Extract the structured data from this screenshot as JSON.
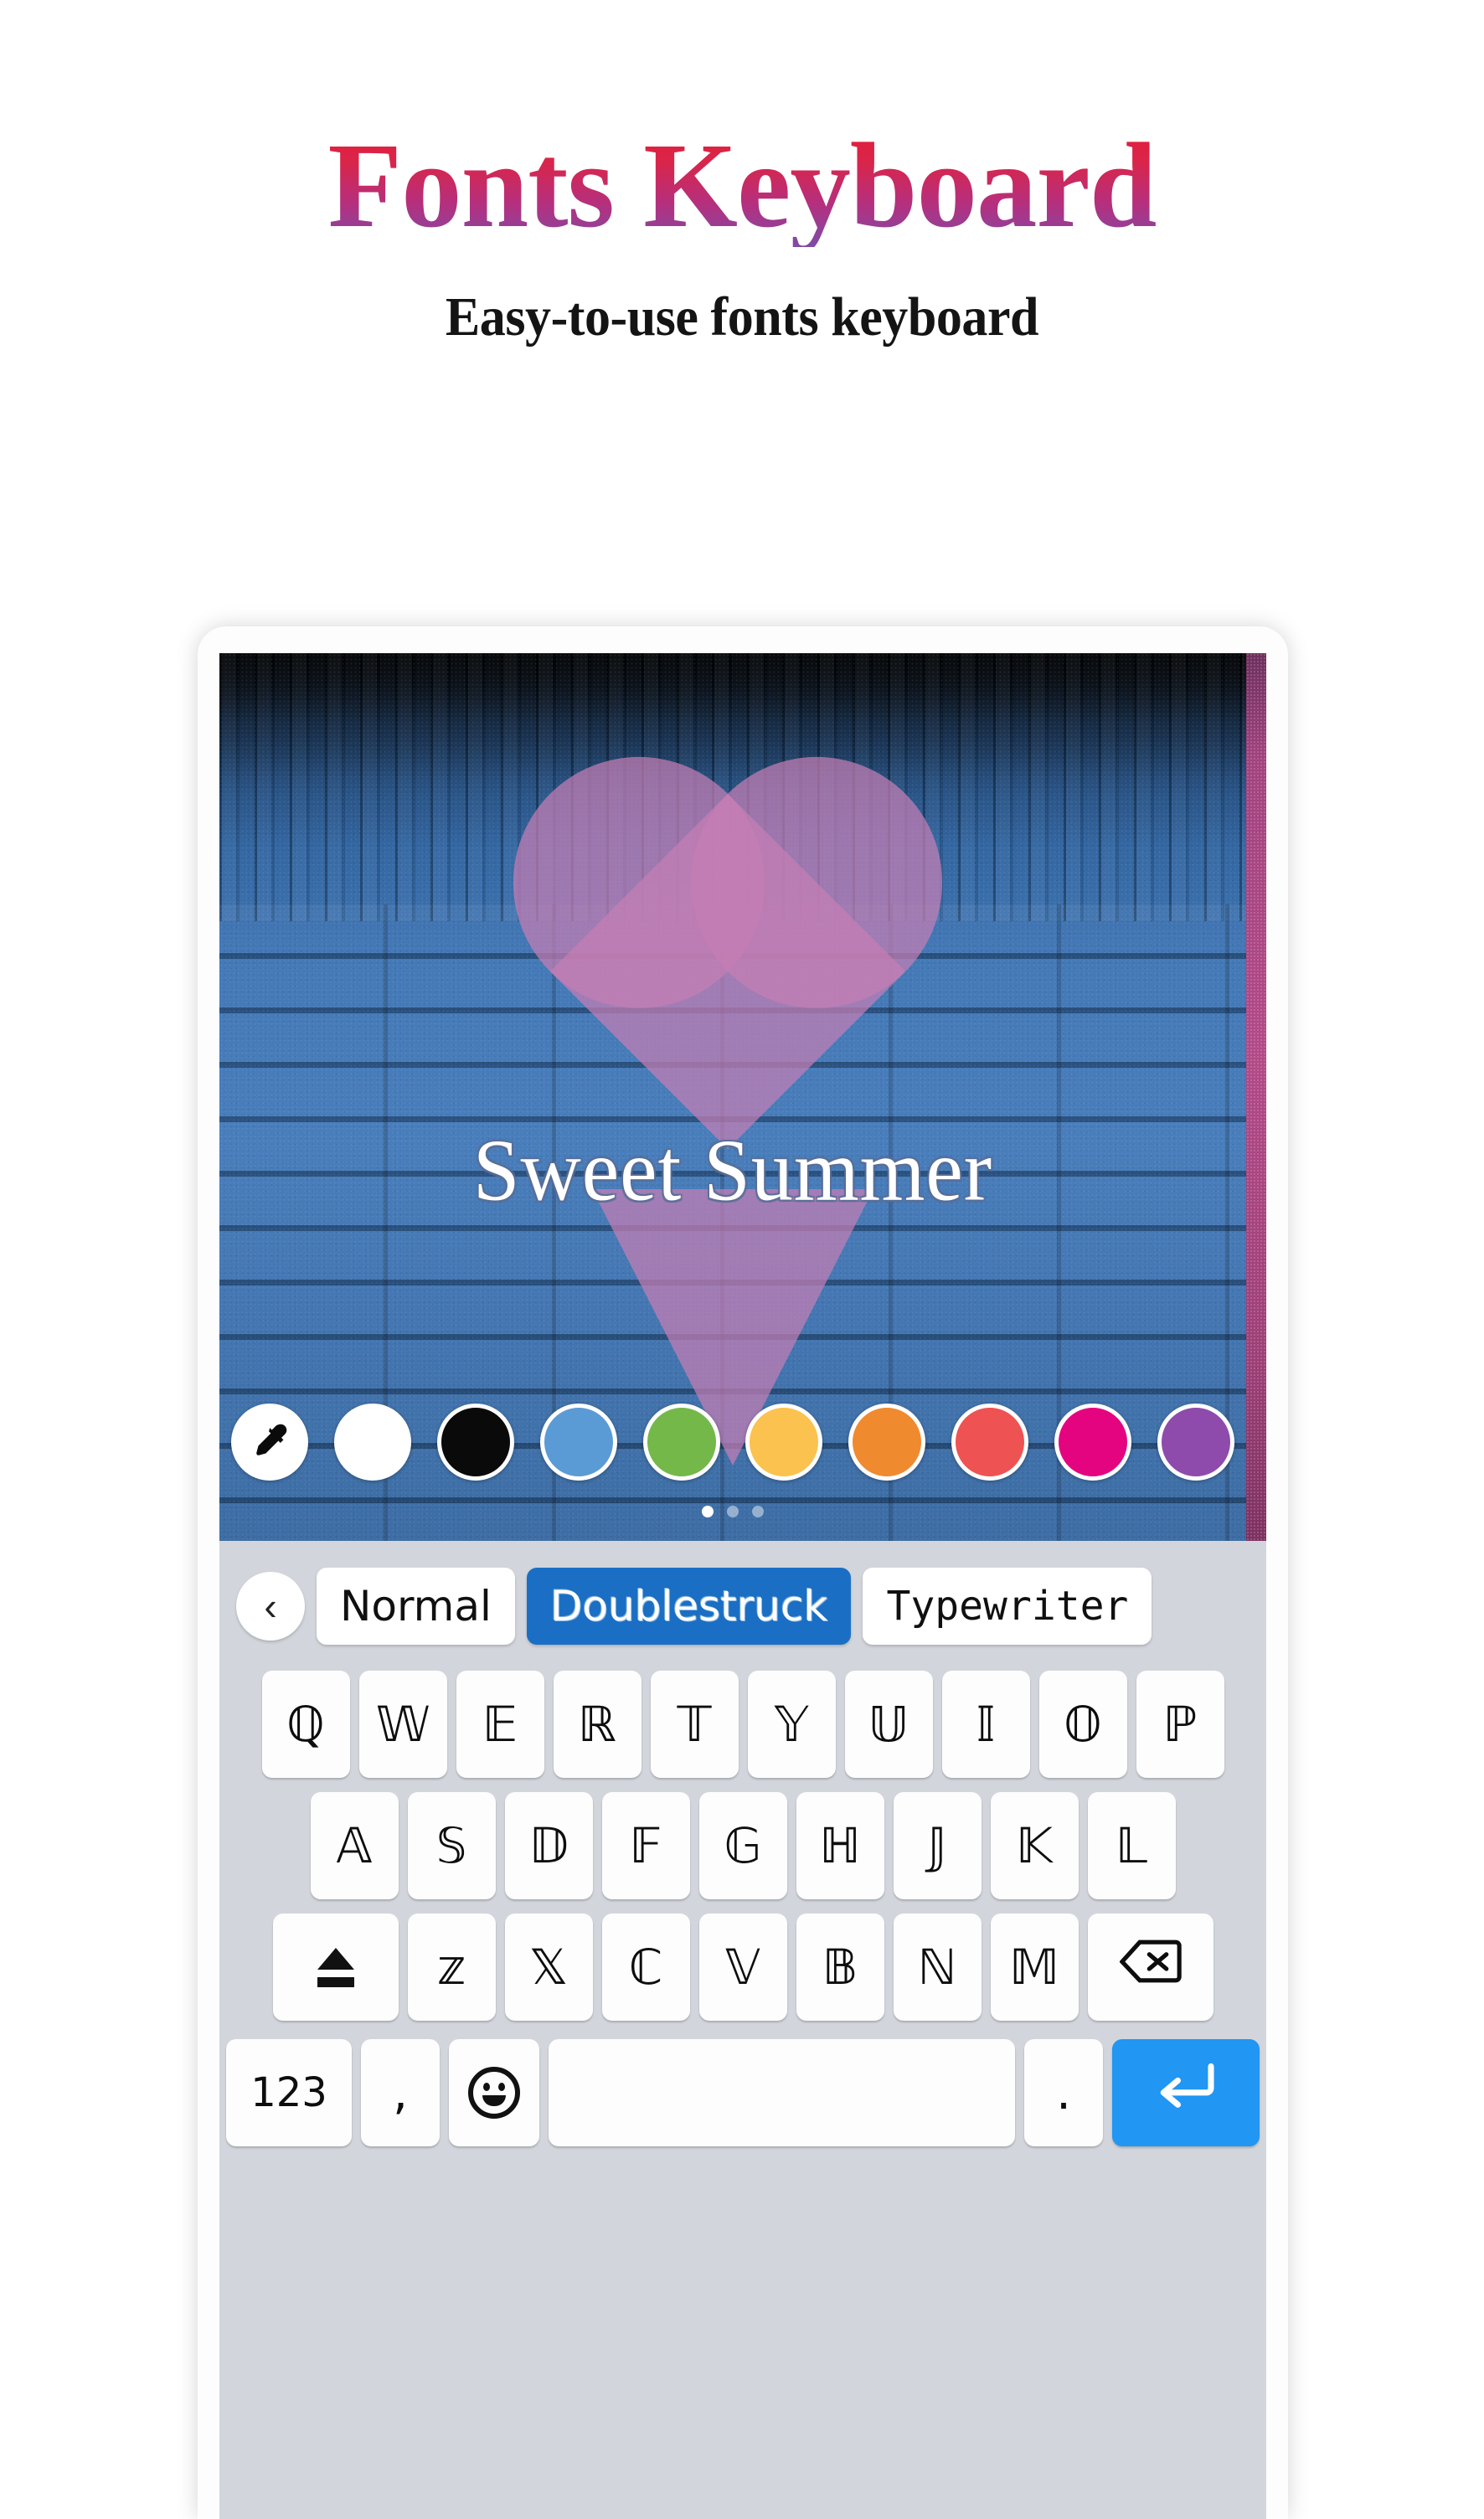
{
  "header": {
    "title": "Fonts Keyboard",
    "subtitle": "Easy-to-use fonts keyboard",
    "title_gradient_from": "#e51d38",
    "title_gradient_to": "#7e4ba6",
    "subtitle_color": "#141414"
  },
  "phone": {
    "canvas": {
      "text": "Sweet Summer",
      "text_color": "#ffffff",
      "wallpaper": "blue-brick-wall-with-pink-heart",
      "heart_color": "#c57eb4",
      "wall_color": "#3f77b8",
      "right_edge_color": "#b24a87"
    },
    "colors": {
      "picker_label": "eyedropper",
      "swatches": [
        {
          "name": "color-picker",
          "hex": "#ffffff",
          "icon": "eyedropper-icon"
        },
        {
          "name": "white",
          "hex": "#ffffff"
        },
        {
          "name": "black",
          "hex": "#0a0a0a"
        },
        {
          "name": "blue",
          "hex": "#5b9bd5"
        },
        {
          "name": "green",
          "hex": "#74b84a"
        },
        {
          "name": "yellow",
          "hex": "#fbc24f"
        },
        {
          "name": "orange",
          "hex": "#f08a2e"
        },
        {
          "name": "coral-red",
          "hex": "#ef5252"
        },
        {
          "name": "magenta",
          "hex": "#e5047f"
        },
        {
          "name": "purple",
          "hex": "#8e4bab"
        }
      ],
      "page_dots": {
        "count": 3,
        "active_index": 0
      }
    },
    "font_bar": {
      "back_icon": "‹",
      "items": [
        {
          "label": "Normal",
          "selected": false
        },
        {
          "label": "Doublestruck",
          "selected": true
        },
        {
          "label": "Typewriter",
          "selected": false
        }
      ],
      "selected_bg": "#1a6fc4"
    },
    "keyboard": {
      "background": "#d2d6dc",
      "key_background": "#fdfdfd",
      "enter_background": "#2196f3",
      "row1": [
        "ℚ",
        "𝕎",
        "𝔼",
        "ℝ",
        "𝕋",
        "𝕐",
        "𝕌",
        "𝕀",
        "𝕆",
        "ℙ"
      ],
      "row2": [
        "𝔸",
        "𝕊",
        "𝔻",
        "𝔽",
        "𝔾",
        "ℍ",
        "𝕁",
        "𝕂",
        "𝕃"
      ],
      "row3": [
        "𝕫",
        "𝕏",
        "ℂ",
        "𝕍",
        "𝔹",
        "ℕ",
        "𝕄"
      ],
      "shift_label": "shift",
      "backspace_label": "backspace",
      "row4": {
        "numbers": "123",
        "comma": ",",
        "emoji": "emoji",
        "space": "",
        "period": ".",
        "enter": "enter"
      }
    }
  }
}
